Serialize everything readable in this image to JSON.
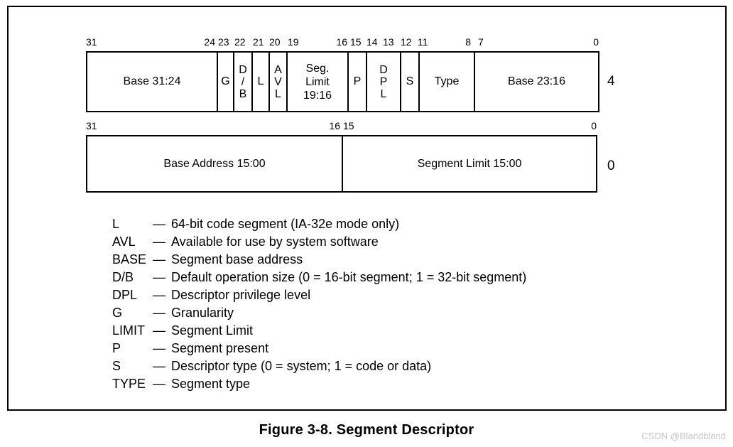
{
  "figure": {
    "caption": "Figure 3-8.  Segment Descriptor",
    "watermark": "CSDN @Blandbland"
  },
  "rows": [
    {
      "id": "high-doubleword",
      "offset_label": "4",
      "bit_labels": [
        {
          "value": "31",
          "bit": 31,
          "align": "left"
        },
        {
          "value": "24",
          "bit": 24,
          "align": "right"
        },
        {
          "value": "23",
          "bit": 23,
          "align": "left"
        },
        {
          "value": "22",
          "bit": 22,
          "align": "left"
        },
        {
          "value": "21",
          "bit": 21,
          "align": "left"
        },
        {
          "value": "20",
          "bit": 20,
          "align": "left"
        },
        {
          "value": "19",
          "bit": 19,
          "align": "left"
        },
        {
          "value": "16",
          "bit": 16,
          "align": "right"
        },
        {
          "value": "15",
          "bit": 15,
          "align": "left"
        },
        {
          "value": "14",
          "bit": 14,
          "align": "left"
        },
        {
          "value": "13",
          "bit": 13,
          "align": "left"
        },
        {
          "value": "12",
          "bit": 12,
          "align": "left"
        },
        {
          "value": "11",
          "bit": 11,
          "align": "left"
        },
        {
          "value": "8",
          "bit": 8,
          "align": "right"
        },
        {
          "value": "7",
          "bit": 7,
          "align": "left"
        },
        {
          "value": "0",
          "bit": 0,
          "align": "right"
        }
      ],
      "fields": [
        {
          "label": "Base 31:24",
          "lines": [
            "Base 31:24"
          ],
          "bits": "31:24"
        },
        {
          "label": "G",
          "lines": [
            "G"
          ],
          "bits": "23"
        },
        {
          "label": "D/B",
          "lines": [
            "D",
            "/",
            "B"
          ],
          "bits": "22"
        },
        {
          "label": "L",
          "lines": [
            "L"
          ],
          "bits": "21"
        },
        {
          "label": "AVL",
          "lines": [
            "A",
            "V",
            "L"
          ],
          "bits": "20"
        },
        {
          "label": "Seg. Limit 19:16",
          "lines": [
            "Seg.",
            "Limit",
            "19:16"
          ],
          "bits": "19:16"
        },
        {
          "label": "P",
          "lines": [
            "P"
          ],
          "bits": "15"
        },
        {
          "label": "DPL",
          "lines": [
            "D",
            "P",
            "L"
          ],
          "bits": "14:13"
        },
        {
          "label": "S",
          "lines": [
            "S"
          ],
          "bits": "12"
        },
        {
          "label": "Type",
          "lines": [
            "Type"
          ],
          "bits": "11:8"
        },
        {
          "label": "Base 23:16",
          "lines": [
            "Base 23:16"
          ],
          "bits": "7:0"
        }
      ]
    },
    {
      "id": "low-doubleword",
      "offset_label": "0",
      "bit_labels": [
        {
          "value": "31",
          "bit": 31,
          "align": "left"
        },
        {
          "value": "16",
          "bit": 16,
          "align": "right"
        },
        {
          "value": "15",
          "bit": 15,
          "align": "left"
        },
        {
          "value": "0",
          "bit": 0,
          "align": "right"
        }
      ],
      "fields": [
        {
          "label": "Base Address 15:00",
          "lines": [
            "Base Address 15:00"
          ],
          "bits": "31:16"
        },
        {
          "label": "Segment Limit 15:00",
          "lines": [
            "Segment Limit 15:00"
          ],
          "bits": "15:0"
        }
      ]
    }
  ],
  "legend": [
    {
      "term": "L",
      "dash": "—",
      "description": "64-bit code segment (IA-32e mode only)"
    },
    {
      "term": "AVL",
      "dash": "—",
      "description": "Available for use by system software"
    },
    {
      "term": "BASE",
      "dash": "—",
      "description": "Segment base address"
    },
    {
      "term": "D/B",
      "dash": "—",
      "description": "Default operation size (0 = 16-bit segment; 1 = 32-bit segment)"
    },
    {
      "term": "DPL",
      "dash": "—",
      "description": "Descriptor privilege level"
    },
    {
      "term": "G",
      "dash": "—",
      "description": "Granularity"
    },
    {
      "term": "LIMIT",
      "dash": "—",
      "description": "Segment Limit"
    },
    {
      "term": "P",
      "dash": "—",
      "description": "Segment present"
    },
    {
      "term": "S",
      "dash": "—",
      "description": "Descriptor type (0 = system; 1 = code or data)"
    },
    {
      "term": "TYPE",
      "dash": "—",
      "description": "Segment type"
    }
  ],
  "colors": {
    "ink": "#000000",
    "background": "#ffffff",
    "watermark": "#c8c8c8"
  }
}
